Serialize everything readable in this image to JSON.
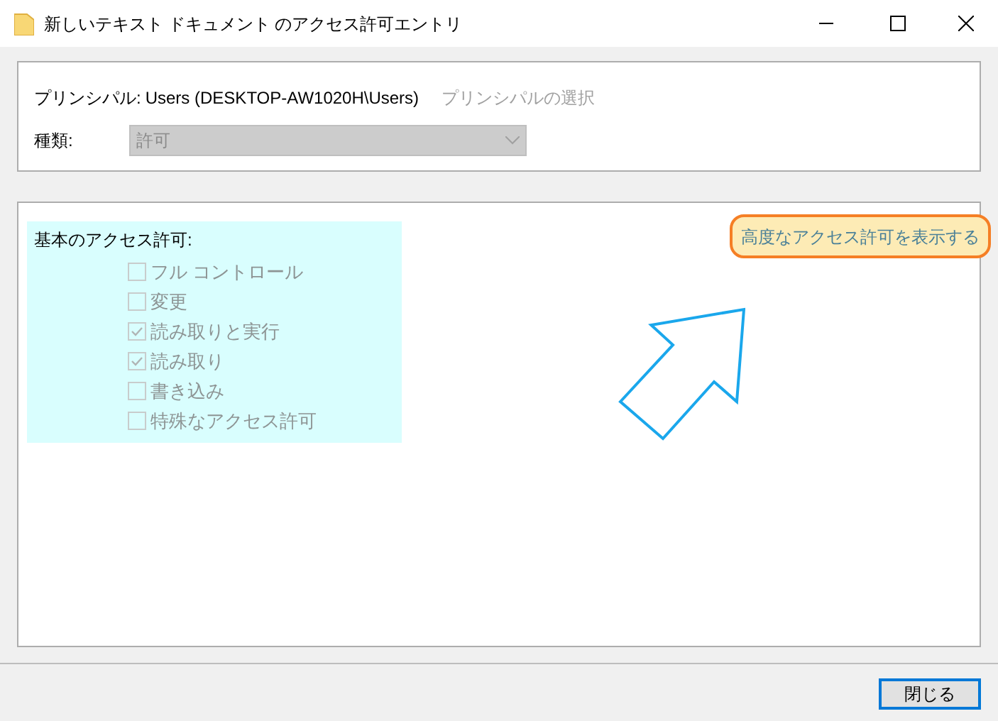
{
  "window": {
    "title": "新しいテキスト ドキュメント のアクセス許可エントリ"
  },
  "principal": {
    "label": "プリンシパル:",
    "value": "Users (DESKTOP-AW1020H\\Users)",
    "link": "プリンシパルの選択"
  },
  "type": {
    "label": "種類:",
    "value": "許可",
    "disabled": true
  },
  "permissions": {
    "title": "基本のアクセス許可:",
    "items": [
      {
        "label": "フル コントロール",
        "checked": false
      },
      {
        "label": "変更",
        "checked": false
      },
      {
        "label": "読み取りと実行",
        "checked": true
      },
      {
        "label": "読み取り",
        "checked": true
      },
      {
        "label": "書き込み",
        "checked": false
      },
      {
        "label": "特殊なアクセス許可",
        "checked": false
      }
    ]
  },
  "advanced_link": "高度なアクセス許可を表示する",
  "buttons": [
    "閉じる"
  ]
}
